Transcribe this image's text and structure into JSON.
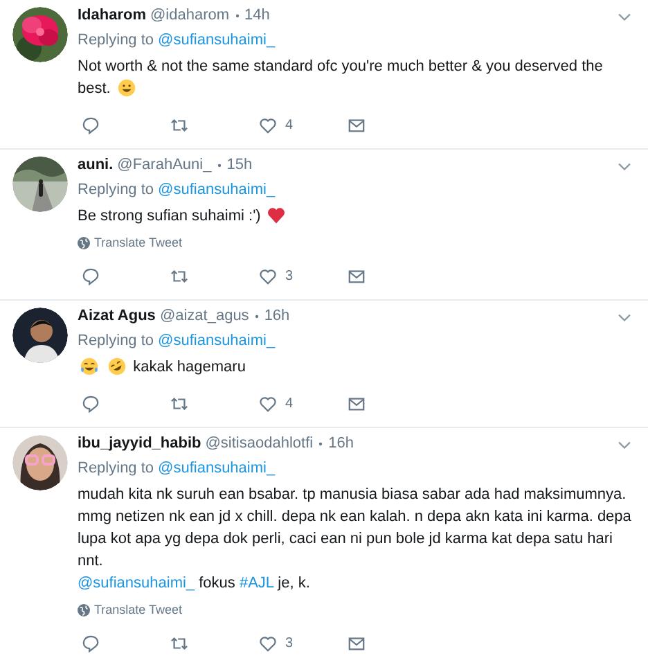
{
  "tweets": [
    {
      "name": "Idaharom",
      "handle": "@idaharom",
      "time": "14h",
      "replying_label": "Replying to",
      "replying_to": "@sufiansuhaimi_",
      "body": [
        [
          {
            "kind": "text",
            "text": "Not worth & not the same standard ofc you're much better & you deserved the"
          }
        ],
        [
          {
            "kind": "text",
            "text": "best."
          },
          {
            "kind": "smiley"
          }
        ]
      ],
      "counts": {
        "likes": "4"
      }
    },
    {
      "name": "auni.",
      "handle": "@FarahAuni_",
      "time": "15h",
      "replying_label": "Replying to",
      "replying_to": "@sufiansuhaimi_",
      "translate": "Translate Tweet",
      "body": [
        [
          {
            "kind": "text",
            "text": "Be strong sufian suhaimi :')"
          },
          {
            "kind": "heart"
          }
        ]
      ],
      "counts": {
        "likes": "3"
      }
    },
    {
      "name": "Aizat Agus",
      "handle": "@aizat_agus",
      "time": "16h",
      "replying_label": "Replying to",
      "replying_to": "@sufiansuhaimi_",
      "body": [
        [
          {
            "kind": "tears"
          },
          {
            "kind": "rolling"
          },
          {
            "kind": "text",
            "text": "kakak hagemaru"
          }
        ]
      ],
      "counts": {
        "likes": "4"
      }
    },
    {
      "name": "ibu_jayyid_habib",
      "handle": "@sitisaodahlotfi",
      "time": "16h",
      "replying_label": "Replying to",
      "replying_to": "@sufiansuhaimi_",
      "translate": "Translate Tweet",
      "body": [
        [
          {
            "kind": "text",
            "text": "mudah kita nk suruh ean bsabar. tp manusia biasa sabar ada had maksimumnya. mmg netizen nk ean jd x chill. depa nk ean kalah. n depa akn kata ini karma. depa lupa kot apa yg depa dok perli, caci ean ni pun bole jd karma kat depa satu hari nnt."
          }
        ],
        [
          {
            "kind": "link",
            "text": "@sufiansuhaimi_"
          },
          {
            "kind": "text",
            "text": " fokus "
          },
          {
            "kind": "link",
            "text": "#AJL"
          },
          {
            "kind": "text",
            "text": " je, k."
          }
        ]
      ],
      "counts": {
        "likes": "3"
      }
    }
  ]
}
